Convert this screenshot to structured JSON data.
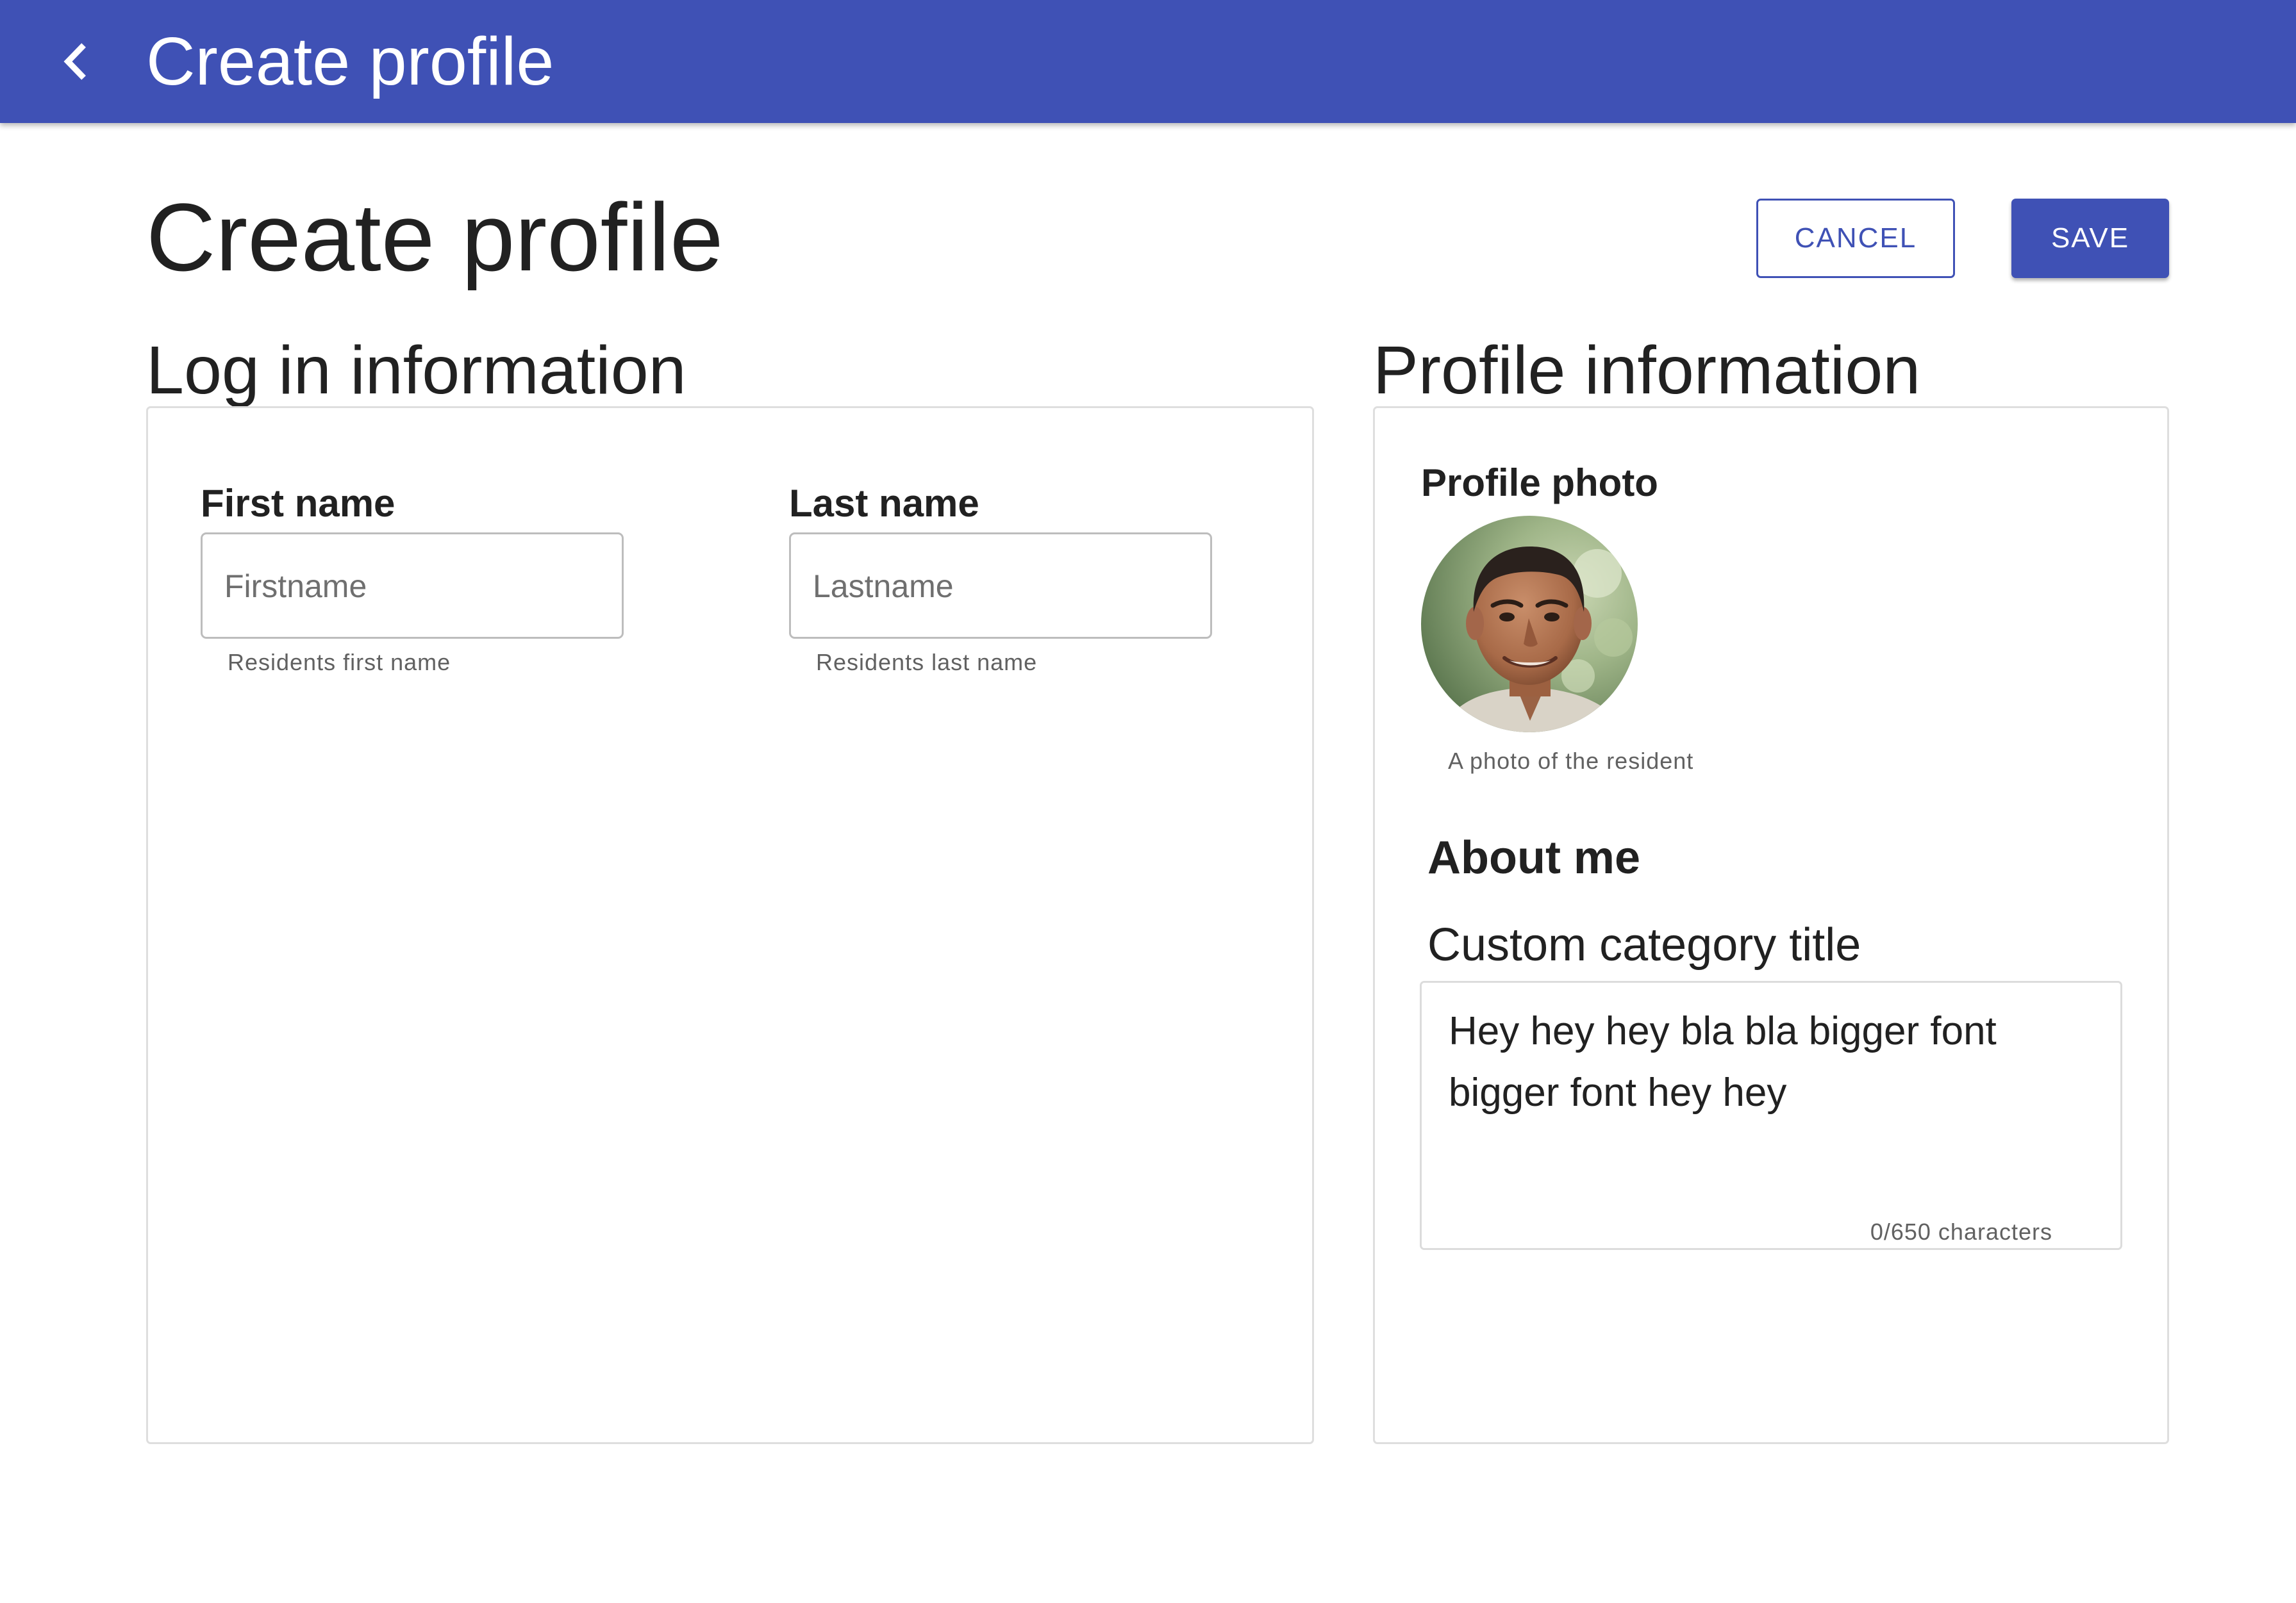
{
  "appbar": {
    "title": "Create profile",
    "back_icon": "chevron-left-icon",
    "color": "#3f51b5"
  },
  "page": {
    "title": "Create profile"
  },
  "actions": {
    "cancel_label": "CANCEL",
    "save_label": "SAVE"
  },
  "login_section": {
    "title": "Log in information",
    "first_name": {
      "label": "First name",
      "value": "",
      "placeholder": "Firstname",
      "helper": "Residents first name"
    },
    "last_name": {
      "label": "Last name",
      "value": "",
      "placeholder": "Lastname",
      "helper": "Residents last name"
    }
  },
  "profile_section": {
    "title": "Profile information",
    "photo_label": "Profile photo",
    "photo_helper": "A photo of the resident",
    "about_title": "About me",
    "category_title": "Custom category title",
    "about_text": "Hey hey hey bla bla bigger font bigger font hey hey",
    "char_counter": "0/650 characters"
  },
  "colors": {
    "primary": "#3f51b5",
    "text": "#212121",
    "helper": "#616161"
  }
}
